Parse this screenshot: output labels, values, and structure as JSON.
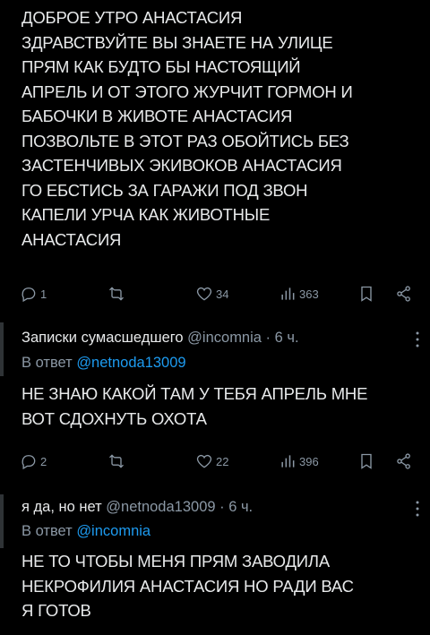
{
  "post1": {
    "text": "ДОБРОЕ УТРО АНАСТАСИЯ\nЗДРАВСТВУЙТЕ ВЫ ЗНАЕТЕ НА УЛИЦЕ\nПРЯМ КАК БУДТО БЫ НАСТОЯЩИЙ\nАПРЕЛЬ И ОТ ЭТОГО ЖУРЧИТ ГОРМОН И\nБАБОЧКИ В ЖИВОТЕ АНАСТАСИЯ\nПОЗВОЛЬТЕ В ЭТОТ РАЗ ОБОЙТИСЬ БЕЗ\nЗАСТЕНЧИВЫХ ЭКИВОКОВ АНАСТАСИЯ\nГО ЕБСТИСЬ ЗА ГАРАЖИ ПОД ЗВОН\nКАПЕЛИ УРЧА КАК ЖИВОТНЫЕ\nАНАСТАСИЯ",
    "replies": "1",
    "likes": "34",
    "views": "363"
  },
  "post2": {
    "author": "Записки сумасшедшего",
    "handle": "@incomnia · 6 ч.",
    "reply_prefix": "В ответ ",
    "reply_to": "@netnoda13009",
    "text": "НЕ ЗНАЮ КАКОЙ ТАМ У ТЕБЯ АПРЕЛЬ МНЕ\nВОТ СДОХНУТЬ ОХОТА",
    "replies": "2",
    "likes": "22",
    "views": "396"
  },
  "post3": {
    "author": "я да, но нет",
    "handle": "@netnoda13009 · 6 ч.",
    "reply_prefix": "В ответ ",
    "reply_to": "@incomnia",
    "text": "НЕ ТО ЧТОБЫ МЕНЯ ПРЯМ ЗАВОДИЛА\nНЕКРОФИЛИЯ АНАСТАСИЯ НО РАДИ ВАС\nЯ ГОТОВ"
  },
  "icons": {
    "reply": "comment-icon",
    "retweet": "retweet-icon",
    "like": "heart-icon",
    "views": "bar-chart-icon",
    "bookmark": "bookmark-icon",
    "share": "share-icon",
    "more": "more-icon"
  },
  "colors": {
    "background": "#000000",
    "text": "#e7e9ea",
    "secondary": "#8b98a5",
    "link": "#1d9bf0"
  }
}
